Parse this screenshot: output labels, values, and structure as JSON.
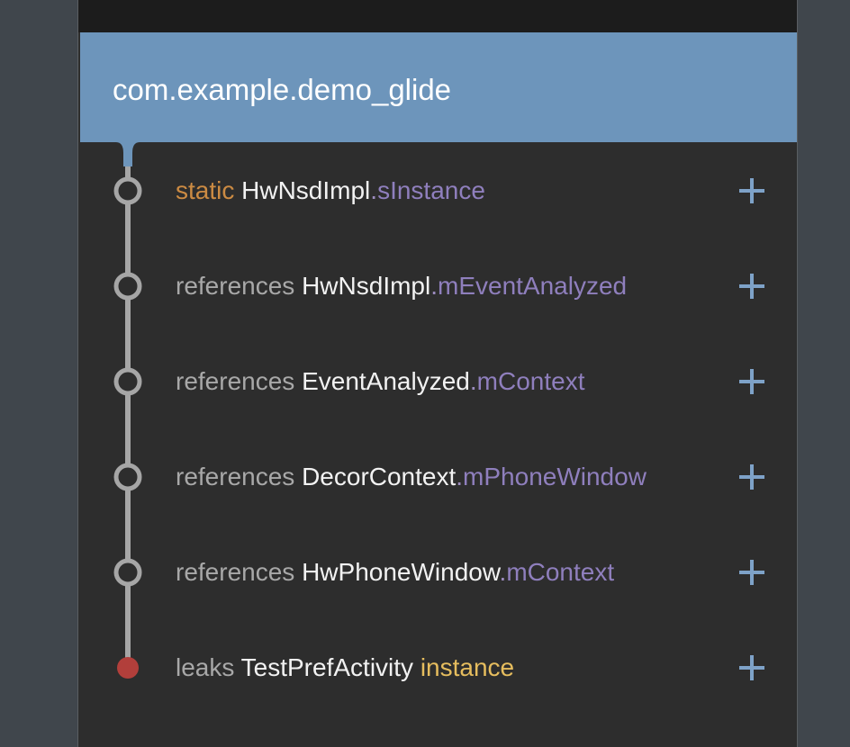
{
  "header": {
    "title": "com.example.demo_glide"
  },
  "trace": {
    "rows": [
      {
        "prefix": "static",
        "class_name": "HwNsdImpl",
        "separator": ".",
        "field": "sInstance",
        "node": "reference"
      },
      {
        "prefix": "references",
        "class_name": "HwNsdImpl",
        "separator": ".",
        "field": "mEventAnalyzed",
        "node": "reference"
      },
      {
        "prefix": "references",
        "class_name": "EventAnalyzed",
        "separator": ".",
        "field": "mContext",
        "node": "reference"
      },
      {
        "prefix": "references",
        "class_name": "DecorContext",
        "separator": ".",
        "field": "mPhoneWindow",
        "node": "reference"
      },
      {
        "prefix": "references",
        "class_name": "HwPhoneWindow",
        "separator": ".",
        "field": "mContext",
        "node": "reference"
      },
      {
        "prefix": "leaks",
        "class_name": "TestPrefActivity",
        "suffix": "instance",
        "node": "leak"
      }
    ],
    "expand_icon": "plus-icon"
  },
  "colors": {
    "header_bg": "#6d95bb",
    "panel_bg": "#2d2d2d",
    "keyword": "#a8a8a8",
    "static_keyword": "#cc8b43",
    "class_name": "#f2f2f2",
    "field_name": "#8f7fbd",
    "instance_keyword": "#e6bd5e",
    "leak_node": "#b23f3b",
    "trace_line": "#a6a6a6",
    "expand_icon": "#7ea2c8"
  }
}
